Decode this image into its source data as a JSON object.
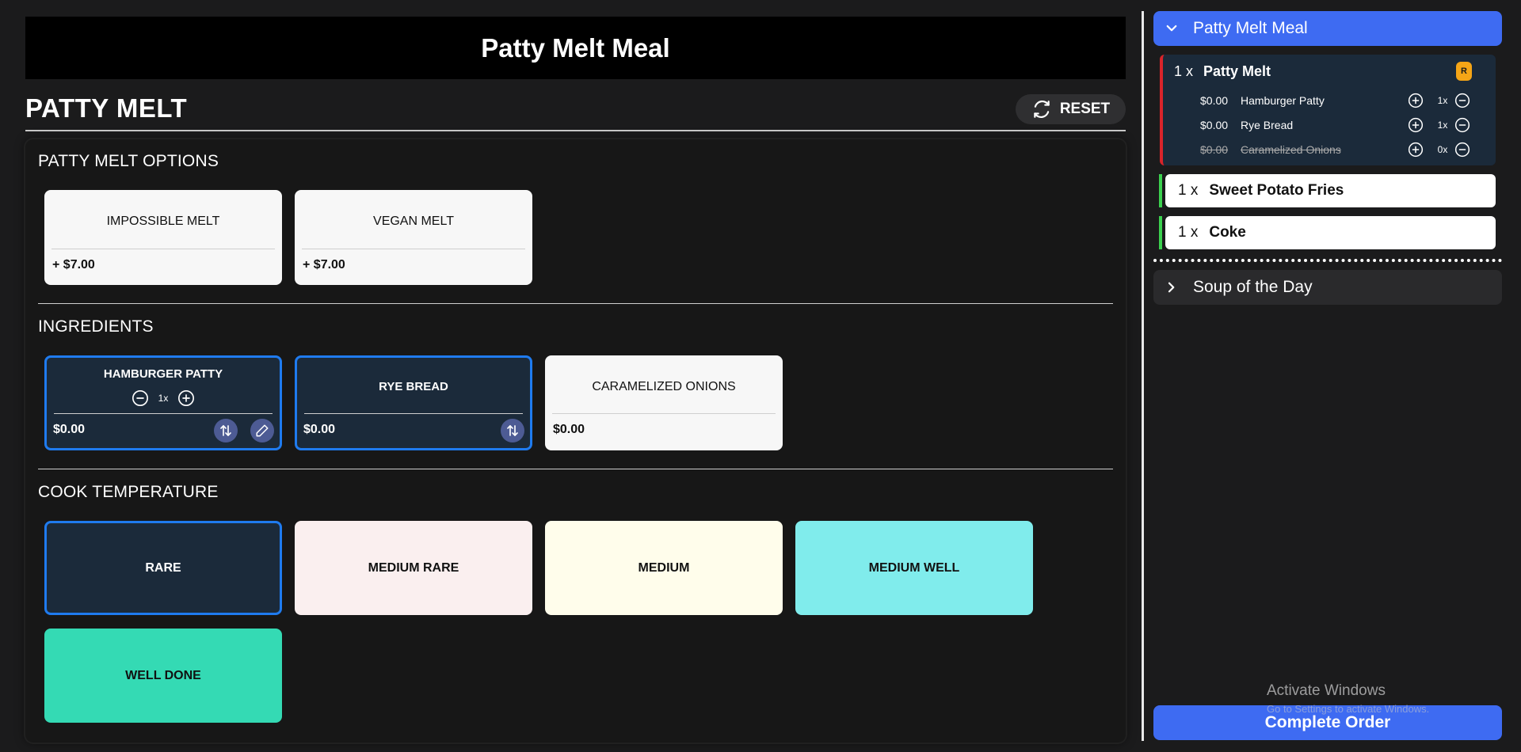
{
  "header": {
    "title": "Patty Melt Meal"
  },
  "section": {
    "title": "PATTY MELT",
    "reset_label": "RESET"
  },
  "options_group": {
    "title": "PATTY MELT OPTIONS",
    "items": [
      {
        "name": "IMPOSSIBLE MELT",
        "price": "+ $7.00"
      },
      {
        "name": "VEGAN MELT",
        "price": "+ $7.00"
      }
    ]
  },
  "ingredients_group": {
    "title": "INGREDIENTS",
    "items": [
      {
        "name": "HAMBURGER PATTY",
        "price": "$0.00",
        "qty": "1x"
      },
      {
        "name": "RYE BREAD",
        "price": "$0.00"
      },
      {
        "name": "CARAMELIZED ONIONS",
        "price": "$0.00"
      }
    ]
  },
  "temperature_group": {
    "title": "COOK TEMPERATURE",
    "items": [
      {
        "label": "RARE",
        "color": "#1b2a3a"
      },
      {
        "label": "MEDIUM RARE",
        "color": "#faefef"
      },
      {
        "label": "MEDIUM",
        "color": "#fffdeb"
      },
      {
        "label": "MEDIUM WELL",
        "color": "#80ecec"
      },
      {
        "label": "WELL DONE",
        "color": "#34dab4"
      }
    ]
  },
  "order": {
    "meal_title": "Patty Melt Meal",
    "items": [
      {
        "qty": "1 x",
        "name": "Patty Melt",
        "badge": "R",
        "modifiers": [
          {
            "price": "$0.00",
            "name": "Hamburger Patty",
            "qty": "1x"
          },
          {
            "price": "$0.00",
            "name": "Rye Bread",
            "qty": "1x"
          },
          {
            "price": "$0.00",
            "name": "Caramelized Onions",
            "qty": "0x"
          }
        ]
      },
      {
        "qty": "1 x",
        "name": "Sweet Potato Fries"
      },
      {
        "qty": "1 x",
        "name": "Coke"
      }
    ],
    "next_meal_title": "Soup of the Day",
    "complete_label": "Complete Order"
  },
  "watermark": {
    "line1": "Activate Windows",
    "line2": "Go to Settings to activate Windows."
  },
  "colors": {
    "accent": "#3e6bf2",
    "selected_border": "#1f7bef",
    "required_badge": "#f5a516",
    "item_bar_red": "#d9242a",
    "item_bar_green": "#3bd14f"
  }
}
